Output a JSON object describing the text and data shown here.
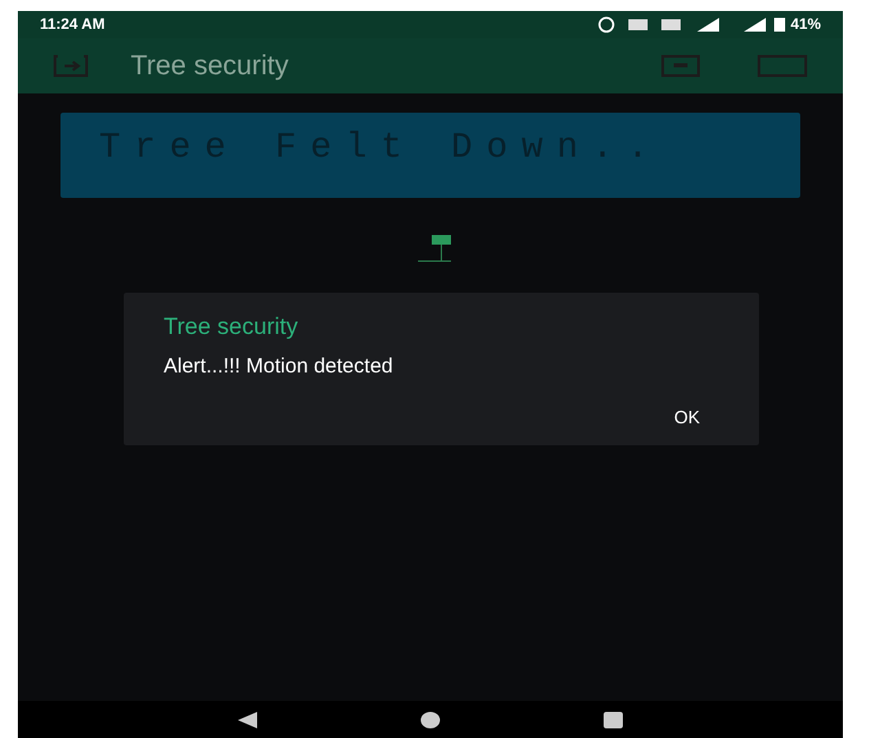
{
  "status_bar": {
    "time": "11:24 AM",
    "battery": "41%"
  },
  "app_bar": {
    "title": "Tree security"
  },
  "display": {
    "text": "Tree Felt Down.."
  },
  "dialog": {
    "title": "Tree security",
    "message": "Alert...!!! Motion detected",
    "button": "OK"
  }
}
